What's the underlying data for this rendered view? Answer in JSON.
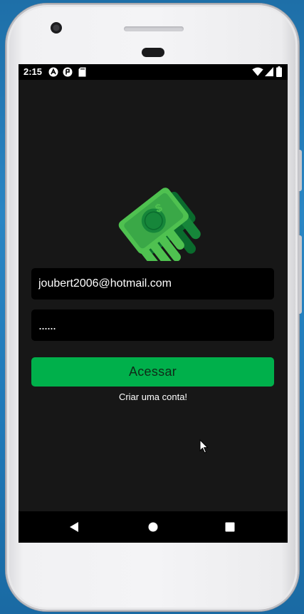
{
  "status_bar": {
    "time": "2:15",
    "left_icons": [
      "react-native-icon",
      "expo-icon",
      "sd-card-icon"
    ],
    "right_icons": [
      "wifi-icon",
      "cell-signal-icon",
      "battery-icon"
    ]
  },
  "logo": {
    "icon": "money-bill-fly-icon",
    "symbol": "$",
    "colors": {
      "light": "#4fc150",
      "dark": "#16863a",
      "darkest": "#0a6b2d"
    }
  },
  "login": {
    "email_value": "joubert2006@hotmail.com",
    "password_value": "......",
    "submit_label": "Acessar",
    "create_account_label": "Criar uma conta!"
  },
  "nav_bar": {
    "icons": [
      "back-icon",
      "home-icon",
      "recents-icon"
    ]
  },
  "colors": {
    "screen_bg": "#171717",
    "field_bg": "#000000",
    "accent": "#00b04b",
    "text": "#ffffff"
  }
}
